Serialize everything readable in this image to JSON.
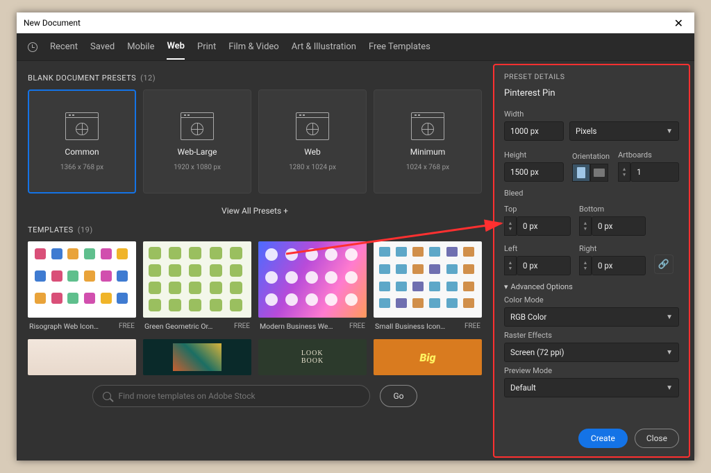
{
  "title": "New Document",
  "tabs": {
    "recent": "Recent",
    "saved": "Saved",
    "mobile": "Mobile",
    "web": "Web",
    "print": "Print",
    "film": "Film & Video",
    "art": "Art & Illustration",
    "free": "Free Templates"
  },
  "sections": {
    "presets_title": "BLANK DOCUMENT PRESETS",
    "presets_count": "(12)",
    "templates_title": "TEMPLATES",
    "templates_count": "(19)",
    "view_all": "View All Presets +"
  },
  "presets": [
    {
      "name": "Common",
      "dim": "1366 x 768 px"
    },
    {
      "name": "Web-Large",
      "dim": "1920 x 1080 px"
    },
    {
      "name": "Web",
      "dim": "1280 x 1024 px"
    },
    {
      "name": "Minimum",
      "dim": "1024 x 768 px"
    }
  ],
  "templates": [
    {
      "name": "Risograph Web Icon…",
      "price": "FREE"
    },
    {
      "name": "Green Geometric Or…",
      "price": "FREE"
    },
    {
      "name": "Modern Business We…",
      "price": "FREE"
    },
    {
      "name": "Small Business Icon…",
      "price": "FREE"
    }
  ],
  "search": {
    "placeholder": "Find more templates on Adobe Stock",
    "go": "Go"
  },
  "details": {
    "header": "PRESET DETAILS",
    "name": "Pinterest Pin",
    "width_label": "Width",
    "width_value": "1000 px",
    "units": "Pixels",
    "height_label": "Height",
    "height_value": "1500 px",
    "orientation_label": "Orientation",
    "artboards_label": "Artboards",
    "artboards_value": "1",
    "bleed_label": "Bleed",
    "top": "Top",
    "bottom": "Bottom",
    "left": "Left",
    "right": "Right",
    "bleed_val": "0 px",
    "advanced": "Advanced Options",
    "color_mode_label": "Color Mode",
    "color_mode": "RGB Color",
    "raster_label": "Raster Effects",
    "raster": "Screen (72 ppi)",
    "preview_label": "Preview Mode",
    "preview": "Default",
    "create": "Create",
    "close": "Close"
  }
}
